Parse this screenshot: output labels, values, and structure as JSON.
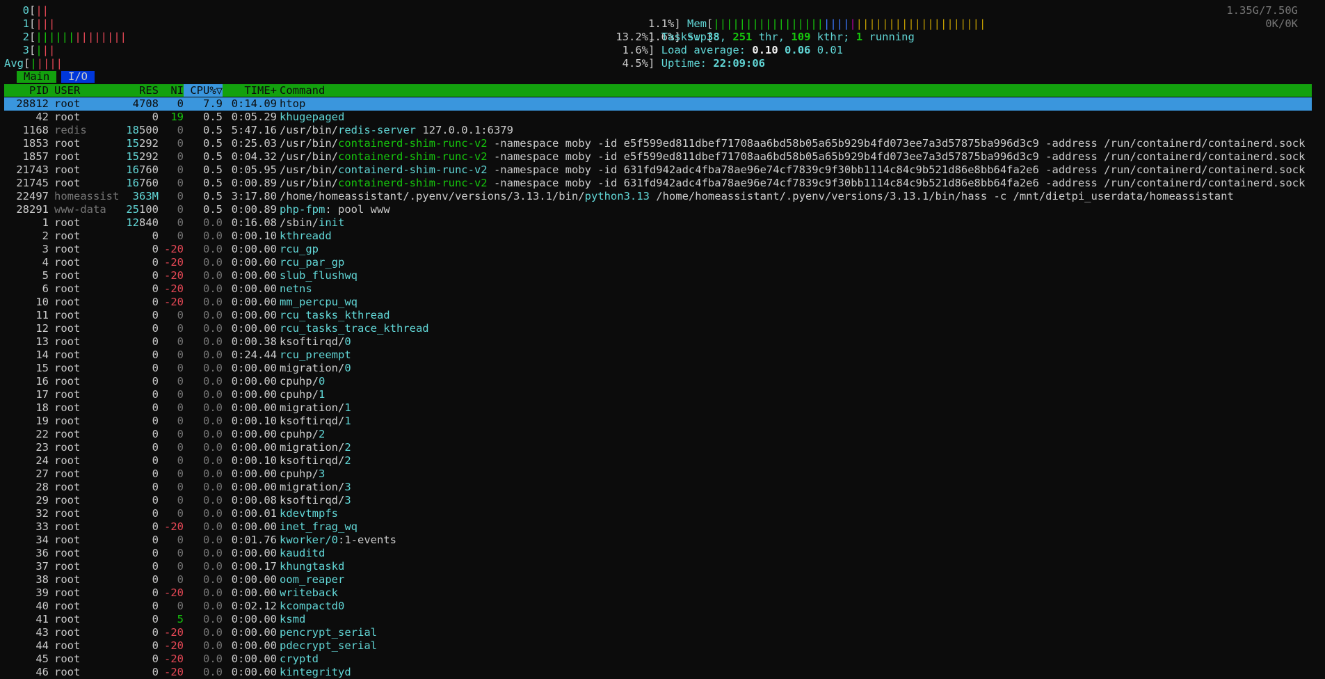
{
  "meters": {
    "cpus": [
      {
        "id": "0",
        "bars": [
          {
            "c": "red",
            "t": "||"
          }
        ]
      },
      {
        "id": "1",
        "bars": [
          {
            "c": "red",
            "t": "|||"
          }
        ]
      },
      {
        "id": "2",
        "bars": [
          {
            "c": "green",
            "t": "||||||"
          },
          {
            "c": "red",
            "t": "||||||||"
          }
        ]
      },
      {
        "id": "3",
        "bars": [
          {
            "c": "green",
            "t": "|"
          },
          {
            "c": "red",
            "t": "||"
          }
        ]
      },
      {
        "id": "Avg",
        "bars": [
          {
            "c": "green",
            "t": "|"
          },
          {
            "c": "red",
            "t": "||||"
          }
        ]
      }
    ],
    "bracket_open": "[",
    "bracket_close": "]",
    "right": [
      {
        "pct": "1.1%",
        "label": "Mem",
        "bars": [
          {
            "c": "green",
            "t": "|||||||||||||||||"
          },
          {
            "c": "blue",
            "t": "||||"
          },
          {
            "c": "magenta",
            "t": "|"
          },
          {
            "c": "yellow",
            "t": "||||||||||||||||||||"
          }
        ],
        "value": "1.35G/7.50G"
      },
      {
        "pct": "1.6%",
        "label": "Swp",
        "bars": [],
        "value": "0K/0K"
      }
    ],
    "tasks": {
      "pct": "13.2%",
      "label": "Tasks:",
      "count": "38",
      "sep1": ",",
      "thr": "251",
      "thr_label": "thr,",
      "kthr": "109",
      "kthr_label": "kthr;",
      "running": "1",
      "running_label": "running"
    },
    "load": {
      "pct": "1.6%",
      "label": "Load average:",
      "v1": "0.10",
      "v2": "0.06",
      "v3": "0.01"
    },
    "uptime": {
      "pct": "4.5%",
      "label": "Uptime:",
      "value": "22:09:06"
    }
  },
  "tabs": {
    "main": "Main",
    "io": "I/O"
  },
  "columns": {
    "pid": "PID",
    "user": "USER",
    "res": "RES",
    "ni": "NI",
    "cpu": "CPU%▽",
    "time": "TIME+",
    "command": "Command"
  },
  "processes": [
    {
      "pid": "28812",
      "user": "root",
      "res": "4708",
      "ni": "0",
      "cpu": "7.9",
      "time": "0:14.09",
      "cmd": [
        {
          "c": "",
          "t": "htop"
        }
      ],
      "selected": true
    },
    {
      "pid": "42",
      "user": "root",
      "res": "0",
      "ni": "19",
      "cpu": "0.5",
      "time": "0:05.29",
      "cmd": [
        {
          "c": "cyan",
          "t": "khugepaged"
        }
      ]
    },
    {
      "pid": "1168",
      "user": "redis",
      "res": "18500",
      "ni": "0",
      "cpu": "0.5",
      "time": "5:47.16",
      "cmd": [
        {
          "c": "",
          "t": "/usr/bin/"
        },
        {
          "c": "cyan",
          "t": "redis-server"
        },
        {
          "c": "",
          "t": " 127.0.0.1:6379"
        }
      ]
    },
    {
      "pid": "1853",
      "user": "root",
      "res": "15292",
      "ni": "0",
      "cpu": "0.5",
      "time": "0:25.03",
      "cmd": [
        {
          "c": "",
          "t": "/usr/bin/"
        },
        {
          "c": "green",
          "t": "containerd-shim-runc-v2"
        },
        {
          "c": "",
          "t": " -namespace moby -id e5f599ed811dbef71708aa6bd58b05a65b929b4fd073ee7a3d57875ba996d3c9 -address /run/containerd/containerd.sock"
        }
      ]
    },
    {
      "pid": "1857",
      "user": "root",
      "res": "15292",
      "ni": "0",
      "cpu": "0.5",
      "time": "0:04.32",
      "cmd": [
        {
          "c": "",
          "t": "/usr/bin/"
        },
        {
          "c": "green",
          "t": "containerd-shim-runc-v2"
        },
        {
          "c": "",
          "t": " -namespace moby -id e5f599ed811dbef71708aa6bd58b05a65b929b4fd073ee7a3d57875ba996d3c9 -address /run/containerd/containerd.sock"
        }
      ]
    },
    {
      "pid": "21743",
      "user": "root",
      "res": "16760",
      "ni": "0",
      "cpu": "0.5",
      "time": "0:05.95",
      "cmd": [
        {
          "c": "",
          "t": "/usr/bin/"
        },
        {
          "c": "cyan",
          "t": "containerd-shim-runc-v2"
        },
        {
          "c": "",
          "t": " -namespace moby -id 631fd942adc4fba78ae96e74cf7839c9f30bb1114c84c9b521d86e8bb64fa2e6 -address /run/containerd/containerd.sock"
        }
      ]
    },
    {
      "pid": "21745",
      "user": "root",
      "res": "16760",
      "ni": "0",
      "cpu": "0.5",
      "time": "0:00.89",
      "cmd": [
        {
          "c": "",
          "t": "/usr/bin/"
        },
        {
          "c": "green",
          "t": "containerd-shim-runc-v2"
        },
        {
          "c": "",
          "t": " -namespace moby -id 631fd942adc4fba78ae96e74cf7839c9f30bb1114c84c9b521d86e8bb64fa2e6 -address /run/containerd/containerd.sock"
        }
      ]
    },
    {
      "pid": "22497",
      "user": "homeassist",
      "res": "363M",
      "ni": "0",
      "cpu": "0.5",
      "time": "3:17.80",
      "cmd": [
        {
          "c": "",
          "t": "/home/homeassistant/.pyenv/versions/3.13.1/bin/"
        },
        {
          "c": "cyan",
          "t": "python3.13"
        },
        {
          "c": "",
          "t": " /home/homeassistant/.pyenv/versions/3.13.1/bin/hass -c /mnt/dietpi_userdata/homeassistant"
        }
      ]
    },
    {
      "pid": "28291",
      "user": "www-data",
      "res": "25100",
      "ni": "0",
      "cpu": "0.5",
      "time": "0:00.89",
      "cmd": [
        {
          "c": "cyan",
          "t": "php-fpm"
        },
        {
          "c": "",
          "t": ": pool www"
        }
      ]
    },
    {
      "pid": "1",
      "user": "root",
      "res": "12840",
      "ni": "0",
      "cpu": "0.0",
      "time": "0:16.08",
      "cmd": [
        {
          "c": "",
          "t": "/sbin/"
        },
        {
          "c": "cyan",
          "t": "init"
        }
      ]
    },
    {
      "pid": "2",
      "user": "root",
      "res": "0",
      "ni": "0",
      "cpu": "0.0",
      "time": "0:00.10",
      "cmd": [
        {
          "c": "cyan",
          "t": "kthreadd"
        }
      ]
    },
    {
      "pid": "3",
      "user": "root",
      "res": "0",
      "ni": "-20",
      "cpu": "0.0",
      "time": "0:00.00",
      "cmd": [
        {
          "c": "cyan",
          "t": "rcu_gp"
        }
      ]
    },
    {
      "pid": "4",
      "user": "root",
      "res": "0",
      "ni": "-20",
      "cpu": "0.0",
      "time": "0:00.00",
      "cmd": [
        {
          "c": "cyan",
          "t": "rcu_par_gp"
        }
      ]
    },
    {
      "pid": "5",
      "user": "root",
      "res": "0",
      "ni": "-20",
      "cpu": "0.0",
      "time": "0:00.00",
      "cmd": [
        {
          "c": "cyan",
          "t": "slub_flushwq"
        }
      ]
    },
    {
      "pid": "6",
      "user": "root",
      "res": "0",
      "ni": "-20",
      "cpu": "0.0",
      "time": "0:00.00",
      "cmd": [
        {
          "c": "cyan",
          "t": "netns"
        }
      ]
    },
    {
      "pid": "10",
      "user": "root",
      "res": "0",
      "ni": "-20",
      "cpu": "0.0",
      "time": "0:00.00",
      "cmd": [
        {
          "c": "cyan",
          "t": "mm_percpu_wq"
        }
      ]
    },
    {
      "pid": "11",
      "user": "root",
      "res": "0",
      "ni": "0",
      "cpu": "0.0",
      "time": "0:00.00",
      "cmd": [
        {
          "c": "cyan",
          "t": "rcu_tasks_kthread"
        }
      ]
    },
    {
      "pid": "12",
      "user": "root",
      "res": "0",
      "ni": "0",
      "cpu": "0.0",
      "time": "0:00.00",
      "cmd": [
        {
          "c": "cyan",
          "t": "rcu_tasks_trace_kthread"
        }
      ]
    },
    {
      "pid": "13",
      "user": "root",
      "res": "0",
      "ni": "0",
      "cpu": "0.0",
      "time": "0:00.38",
      "cmd": [
        {
          "c": "",
          "t": "ksoftirqd/"
        },
        {
          "c": "cyan",
          "t": "0"
        }
      ]
    },
    {
      "pid": "14",
      "user": "root",
      "res": "0",
      "ni": "0",
      "cpu": "0.0",
      "time": "0:24.44",
      "cmd": [
        {
          "c": "cyan",
          "t": "rcu_preempt"
        }
      ]
    },
    {
      "pid": "15",
      "user": "root",
      "res": "0",
      "ni": "0",
      "cpu": "0.0",
      "time": "0:00.00",
      "cmd": [
        {
          "c": "",
          "t": "migration/"
        },
        {
          "c": "cyan",
          "t": "0"
        }
      ]
    },
    {
      "pid": "16",
      "user": "root",
      "res": "0",
      "ni": "0",
      "cpu": "0.0",
      "time": "0:00.00",
      "cmd": [
        {
          "c": "",
          "t": "cpuhp/"
        },
        {
          "c": "cyan",
          "t": "0"
        }
      ]
    },
    {
      "pid": "17",
      "user": "root",
      "res": "0",
      "ni": "0",
      "cpu": "0.0",
      "time": "0:00.00",
      "cmd": [
        {
          "c": "",
          "t": "cpuhp/"
        },
        {
          "c": "cyan",
          "t": "1"
        }
      ]
    },
    {
      "pid": "18",
      "user": "root",
      "res": "0",
      "ni": "0",
      "cpu": "0.0",
      "time": "0:00.00",
      "cmd": [
        {
          "c": "",
          "t": "migration/"
        },
        {
          "c": "cyan",
          "t": "1"
        }
      ]
    },
    {
      "pid": "19",
      "user": "root",
      "res": "0",
      "ni": "0",
      "cpu": "0.0",
      "time": "0:00.10",
      "cmd": [
        {
          "c": "",
          "t": "ksoftirqd/"
        },
        {
          "c": "cyan",
          "t": "1"
        }
      ]
    },
    {
      "pid": "22",
      "user": "root",
      "res": "0",
      "ni": "0",
      "cpu": "0.0",
      "time": "0:00.00",
      "cmd": [
        {
          "c": "",
          "t": "cpuhp/"
        },
        {
          "c": "cyan",
          "t": "2"
        }
      ]
    },
    {
      "pid": "23",
      "user": "root",
      "res": "0",
      "ni": "0",
      "cpu": "0.0",
      "time": "0:00.00",
      "cmd": [
        {
          "c": "",
          "t": "migration/"
        },
        {
          "c": "cyan",
          "t": "2"
        }
      ]
    },
    {
      "pid": "24",
      "user": "root",
      "res": "0",
      "ni": "0",
      "cpu": "0.0",
      "time": "0:00.10",
      "cmd": [
        {
          "c": "",
          "t": "ksoftirqd/"
        },
        {
          "c": "cyan",
          "t": "2"
        }
      ]
    },
    {
      "pid": "27",
      "user": "root",
      "res": "0",
      "ni": "0",
      "cpu": "0.0",
      "time": "0:00.00",
      "cmd": [
        {
          "c": "",
          "t": "cpuhp/"
        },
        {
          "c": "cyan",
          "t": "3"
        }
      ]
    },
    {
      "pid": "28",
      "user": "root",
      "res": "0",
      "ni": "0",
      "cpu": "0.0",
      "time": "0:00.00",
      "cmd": [
        {
          "c": "",
          "t": "migration/"
        },
        {
          "c": "cyan",
          "t": "3"
        }
      ]
    },
    {
      "pid": "29",
      "user": "root",
      "res": "0",
      "ni": "0",
      "cpu": "0.0",
      "time": "0:00.08",
      "cmd": [
        {
          "c": "",
          "t": "ksoftirqd/"
        },
        {
          "c": "cyan",
          "t": "3"
        }
      ]
    },
    {
      "pid": "32",
      "user": "root",
      "res": "0",
      "ni": "0",
      "cpu": "0.0",
      "time": "0:00.01",
      "cmd": [
        {
          "c": "cyan",
          "t": "kdevtmpfs"
        }
      ]
    },
    {
      "pid": "33",
      "user": "root",
      "res": "0",
      "ni": "-20",
      "cpu": "0.0",
      "time": "0:00.00",
      "cmd": [
        {
          "c": "cyan",
          "t": "inet_frag_wq"
        }
      ]
    },
    {
      "pid": "34",
      "user": "root",
      "res": "0",
      "ni": "0",
      "cpu": "0.0",
      "time": "0:01.76",
      "cmd": [
        {
          "c": "cyan",
          "t": "kworker/0"
        },
        {
          "c": "",
          "t": ":1-events"
        }
      ]
    },
    {
      "pid": "36",
      "user": "root",
      "res": "0",
      "ni": "0",
      "cpu": "0.0",
      "time": "0:00.00",
      "cmd": [
        {
          "c": "cyan",
          "t": "kauditd"
        }
      ]
    },
    {
      "pid": "37",
      "user": "root",
      "res": "0",
      "ni": "0",
      "cpu": "0.0",
      "time": "0:00.17",
      "cmd": [
        {
          "c": "cyan",
          "t": "khungtaskd"
        }
      ]
    },
    {
      "pid": "38",
      "user": "root",
      "res": "0",
      "ni": "0",
      "cpu": "0.0",
      "time": "0:00.00",
      "cmd": [
        {
          "c": "cyan",
          "t": "oom_reaper"
        }
      ]
    },
    {
      "pid": "39",
      "user": "root",
      "res": "0",
      "ni": "-20",
      "cpu": "0.0",
      "time": "0:00.00",
      "cmd": [
        {
          "c": "cyan",
          "t": "writeback"
        }
      ]
    },
    {
      "pid": "40",
      "user": "root",
      "res": "0",
      "ni": "0",
      "cpu": "0.0",
      "time": "0:02.12",
      "cmd": [
        {
          "c": "cyan",
          "t": "kcompactd0"
        }
      ]
    },
    {
      "pid": "41",
      "user": "root",
      "res": "0",
      "ni": "5",
      "cpu": "0.0",
      "time": "0:00.00",
      "cmd": [
        {
          "c": "cyan",
          "t": "ksmd"
        }
      ]
    },
    {
      "pid": "43",
      "user": "root",
      "res": "0",
      "ni": "-20",
      "cpu": "0.0",
      "time": "0:00.00",
      "cmd": [
        {
          "c": "cyan",
          "t": "pencrypt_serial"
        }
      ]
    },
    {
      "pid": "44",
      "user": "root",
      "res": "0",
      "ni": "-20",
      "cpu": "0.0",
      "time": "0:00.00",
      "cmd": [
        {
          "c": "cyan",
          "t": "pdecrypt_serial"
        }
      ]
    },
    {
      "pid": "45",
      "user": "root",
      "res": "0",
      "ni": "-20",
      "cpu": "0.0",
      "time": "0:00.00",
      "cmd": [
        {
          "c": "cyan",
          "t": "cryptd"
        }
      ]
    },
    {
      "pid": "46",
      "user": "root",
      "res": "0",
      "ni": "-20",
      "cpu": "0.0",
      "time": "0:00.00",
      "cmd": [
        {
          "c": "cyan",
          "t": "kintegrityd"
        }
      ]
    }
  ]
}
